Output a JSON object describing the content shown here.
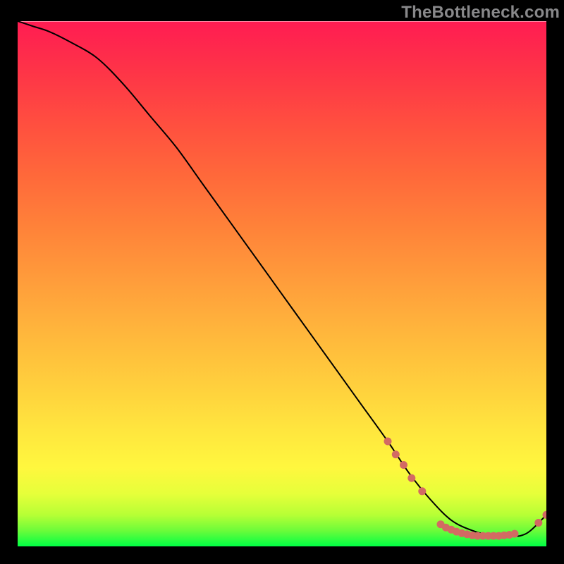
{
  "watermark": "TheBottleneck.com",
  "tiny_label": "",
  "chart_data": {
    "type": "line",
    "title": "",
    "xlabel": "",
    "ylabel": "",
    "xlim": [
      0,
      100
    ],
    "ylim": [
      0,
      100
    ],
    "grid": false,
    "series": [
      {
        "name": "curve",
        "x": [
          0,
          3,
          6,
          10,
          15,
          20,
          25,
          30,
          35,
          40,
          45,
          50,
          55,
          60,
          65,
          70,
          74,
          78,
          82,
          86,
          90,
          93,
          95,
          97,
          100
        ],
        "y": [
          100,
          99,
          98,
          96,
          93,
          88,
          82,
          76,
          69,
          62,
          55,
          48,
          41,
          34,
          27,
          20,
          14,
          9,
          5,
          3,
          2,
          2,
          2,
          3,
          6
        ]
      }
    ],
    "markers": [
      {
        "x": 70,
        "y": 20
      },
      {
        "x": 71.5,
        "y": 17.5
      },
      {
        "x": 73,
        "y": 15.5
      },
      {
        "x": 74.5,
        "y": 13
      },
      {
        "x": 76.5,
        "y": 10.5
      },
      {
        "x": 80,
        "y": 4.2
      },
      {
        "x": 81,
        "y": 3.6
      },
      {
        "x": 82,
        "y": 3.2
      },
      {
        "x": 83,
        "y": 2.8
      },
      {
        "x": 84,
        "y": 2.5
      },
      {
        "x": 85,
        "y": 2.3
      },
      {
        "x": 86,
        "y": 2.1
      },
      {
        "x": 87,
        "y": 2.0
      },
      {
        "x": 88,
        "y": 2.0
      },
      {
        "x": 89,
        "y": 2.0
      },
      {
        "x": 90,
        "y": 2.0
      },
      {
        "x": 91,
        "y": 2.0
      },
      {
        "x": 92,
        "y": 2.1
      },
      {
        "x": 93,
        "y": 2.2
      },
      {
        "x": 94,
        "y": 2.4
      },
      {
        "x": 98.5,
        "y": 4.5
      },
      {
        "x": 100,
        "y": 6.0
      }
    ]
  }
}
